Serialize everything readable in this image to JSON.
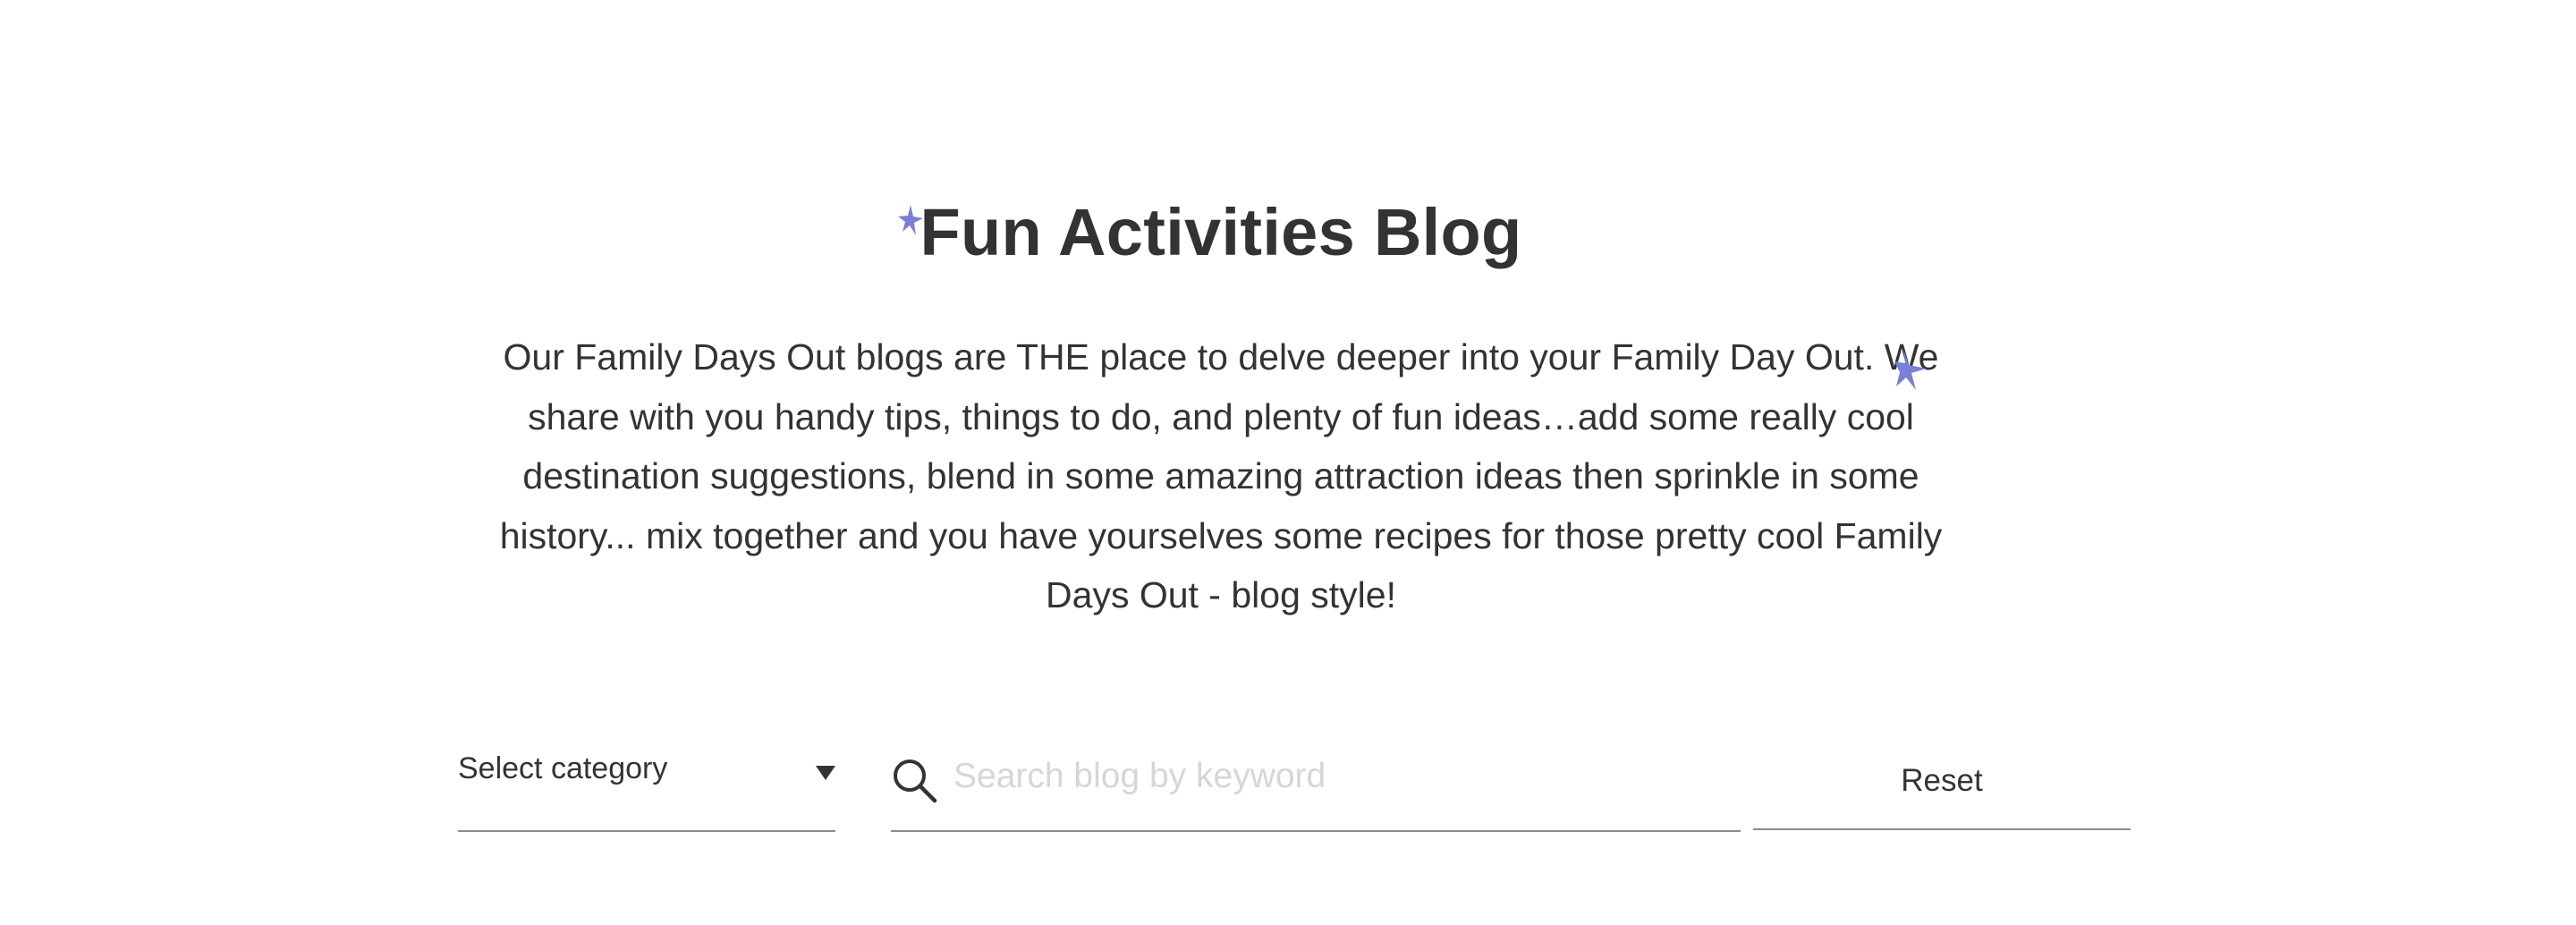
{
  "header": {
    "title": "Fun Activities Blog",
    "intro": "Our Family Days Out blogs are THE place to delve deeper into your Family Day Out. We share with you handy tips, things to do, and plenty of fun ideas…add some really cool destination suggestions, blend in some amazing attraction ideas then sprinkle in some history... mix together and you have yourselves some recipes for those pretty cool Family Days Out - blog style!"
  },
  "filters": {
    "category_select": {
      "selected_label": "Select category",
      "icon": "caret-down-icon"
    },
    "search": {
      "placeholder": "Search blog by keyword",
      "value": "",
      "icon": "search-icon"
    },
    "reset_label": "Reset"
  },
  "decorations": {
    "sparkle_icon": "sparkle-icon",
    "sparkle_color": "#7a7fd8"
  },
  "colors": {
    "text": "#333333",
    "placeholder": "#d6d6d6",
    "underline": "#8c8c8c",
    "background": "#ffffff"
  }
}
